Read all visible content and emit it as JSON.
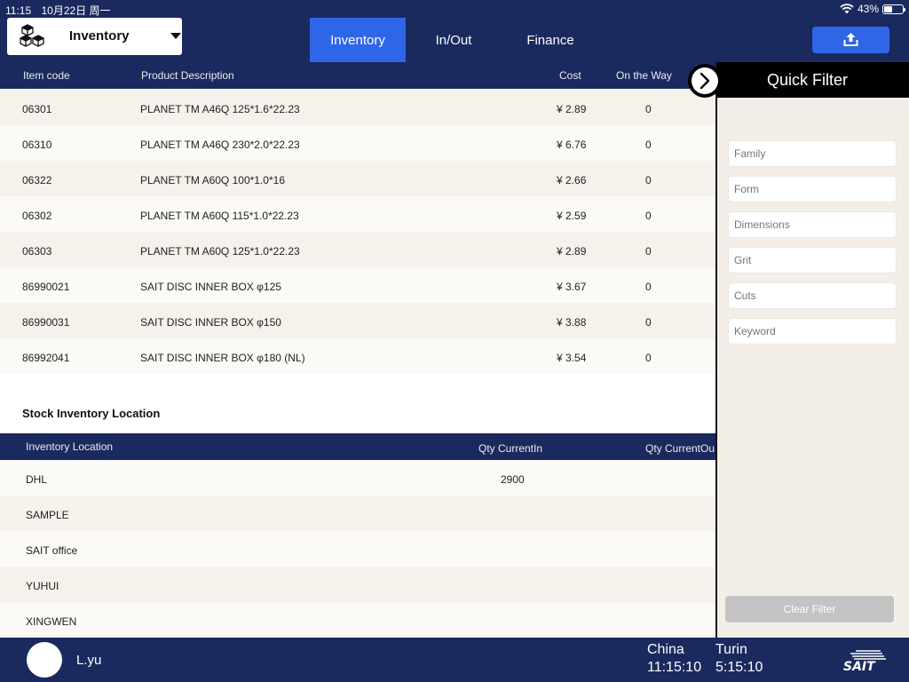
{
  "status_bar": {
    "time": "11:15",
    "date": "10月22日 周一",
    "battery": "43%",
    "battery_level": 0.43
  },
  "header": {
    "selector_label": "Inventory",
    "tabs": [
      {
        "label": "Inventory",
        "active": true
      },
      {
        "label": "In/Out",
        "active": false
      },
      {
        "label": "Finance",
        "active": false
      }
    ]
  },
  "product_table": {
    "columns": [
      "Item code",
      "Product Description",
      "Cost",
      "On the Way"
    ],
    "rows": [
      {
        "code": "06301",
        "desc": "PLANET TM A46Q 125*1.6*22.23",
        "cost": "¥ 2.89",
        "on_way": "0"
      },
      {
        "code": "06310",
        "desc": "PLANET TM A46Q 230*2.0*22.23",
        "cost": "¥ 6.76",
        "on_way": "0"
      },
      {
        "code": "06322",
        "desc": "PLANET TM A60Q 100*1.0*16",
        "cost": "¥ 2.66",
        "on_way": "0"
      },
      {
        "code": "06302",
        "desc": "PLANET TM A60Q 115*1.0*22.23",
        "cost": "¥ 2.59",
        "on_way": "0"
      },
      {
        "code": "06303",
        "desc": "PLANET TM A60Q 125*1.0*22.23",
        "cost": "¥ 2.89",
        "on_way": "0"
      },
      {
        "code": "86990021",
        "desc": "SAIT DISC INNER BOX  φ125",
        "cost": "¥ 3.67",
        "on_way": "0"
      },
      {
        "code": "86990031",
        "desc": "SAIT DISC INNER BOX  φ150",
        "cost": "¥ 3.88",
        "on_way": "0"
      },
      {
        "code": "86992041",
        "desc": "SAIT DISC INNER BOX  φ180 (NL)",
        "cost": "¥ 3.54",
        "on_way": "0"
      }
    ]
  },
  "stock_section": {
    "title": "Stock Inventory Location",
    "columns": [
      "Inventory Location",
      "Qty CurrentIn",
      "Qty CurrentOu"
    ],
    "rows": [
      {
        "location": "DHL",
        "qty_in": "2900",
        "qty_out": ""
      },
      {
        "location": "SAMPLE",
        "qty_in": "",
        "qty_out": ""
      },
      {
        "location": "SAIT office",
        "qty_in": "",
        "qty_out": ""
      },
      {
        "location": "YUHUI",
        "qty_in": "",
        "qty_out": ""
      },
      {
        "location": "XINGWEN",
        "qty_in": "",
        "qty_out": ""
      }
    ]
  },
  "quick_filter": {
    "title": "Quick Filter",
    "fields": [
      {
        "placeholder": "Family"
      },
      {
        "placeholder": "Form"
      },
      {
        "placeholder": "Dimensions"
      },
      {
        "placeholder": "Grit"
      },
      {
        "placeholder": "Cuts"
      },
      {
        "placeholder": "Keyword"
      }
    ],
    "clear_label": "Clear Filter"
  },
  "footer": {
    "username": "L.yu",
    "clocks": [
      {
        "city": "China",
        "time": "11:15:10"
      },
      {
        "city": "Turin",
        "time": "5:15:10"
      }
    ],
    "logo_text": "SAIT"
  },
  "colors": {
    "navy": "#1a2a5e",
    "accent_blue": "#2f66e8",
    "row_alt": "#f5f2ec",
    "panel_bg": "#f3efe8"
  },
  "icons": [
    "cubes-icon",
    "caret-down-icon",
    "upload-icon",
    "chevron-right-icon",
    "wifi-icon",
    "battery-icon",
    "sait-logo"
  ]
}
